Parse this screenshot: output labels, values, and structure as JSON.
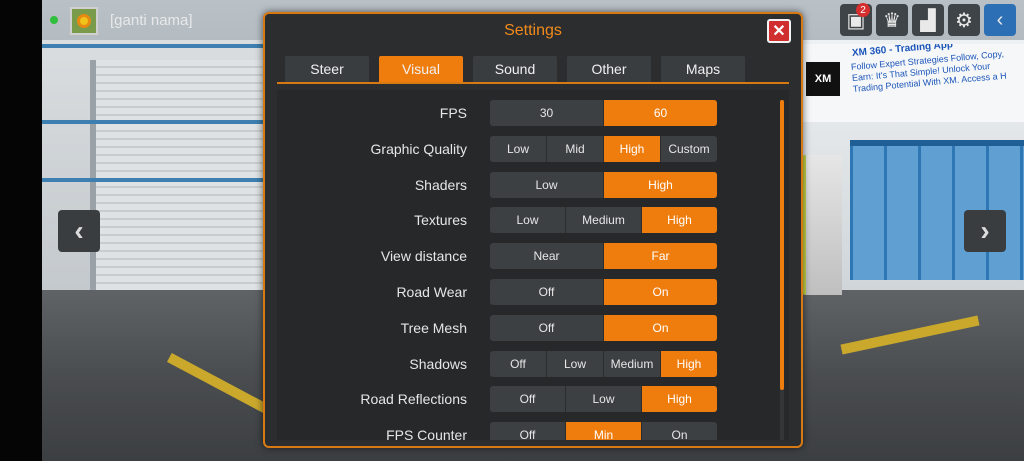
{
  "player": {
    "name": "[ganti nama]"
  },
  "hud": {
    "notification_count": "2"
  },
  "ad": {
    "logo": "XM",
    "title": "XM 360 - Trading App",
    "text": "Follow Expert Strategies Follow, Copy, Earn: It's That Simple! Unlock Your Trading Potential With XM. Access a H"
  },
  "settings": {
    "title": "Settings",
    "close_glyph": "✕",
    "tabs": [
      {
        "label": "Steer",
        "active": false
      },
      {
        "label": "Visual",
        "active": true
      },
      {
        "label": "Sound",
        "active": false
      },
      {
        "label": "Other",
        "active": false
      },
      {
        "label": "Maps",
        "active": false
      }
    ],
    "rows": [
      {
        "label": "FPS",
        "options": [
          "30",
          "60"
        ],
        "selected": 1
      },
      {
        "label": "Graphic Quality",
        "options": [
          "Low",
          "Mid",
          "High",
          "Custom"
        ],
        "selected": 2
      },
      {
        "label": "Shaders",
        "options": [
          "Low",
          "High"
        ],
        "selected": 1
      },
      {
        "label": "Textures",
        "options": [
          "Low",
          "Medium",
          "High"
        ],
        "selected": 2
      },
      {
        "label": "View distance",
        "options": [
          "Near",
          "Far"
        ],
        "selected": 1
      },
      {
        "label": "Road Wear",
        "options": [
          "Off",
          "On"
        ],
        "selected": 1
      },
      {
        "label": "Tree Mesh",
        "options": [
          "Off",
          "On"
        ],
        "selected": 1
      },
      {
        "label": "Shadows",
        "options": [
          "Off",
          "Low",
          "Medium",
          "High"
        ],
        "selected": 3
      },
      {
        "label": "Road Reflections",
        "options": [
          "Off",
          "Low",
          "High"
        ],
        "selected": 2
      },
      {
        "label": "FPS Counter",
        "options": [
          "Off",
          "Min",
          "On"
        ],
        "selected": 1
      }
    ]
  },
  "colors": {
    "accent": "#ef7d0e",
    "panel": "#2b2d2f",
    "close": "#d12f2f"
  }
}
